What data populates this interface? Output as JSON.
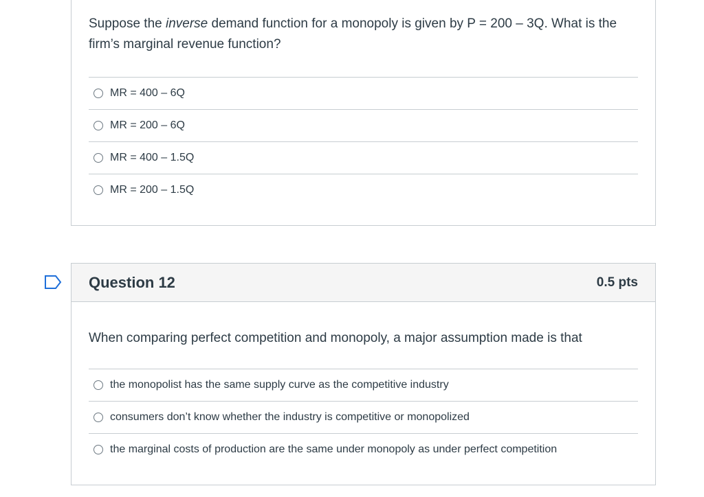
{
  "question11": {
    "text_before": "Suppose the ",
    "text_em": "inverse",
    "text_after": " demand function for a monopoly is given by P = 200 – 3Q.  What is the firm’s marginal revenue function?",
    "answers": [
      {
        "label": "MR = 400 – 6Q"
      },
      {
        "label": "MR = 200 – 6Q"
      },
      {
        "label": "MR = 400 – 1.5Q"
      },
      {
        "label": "MR = 200 – 1.5Q"
      }
    ]
  },
  "question12": {
    "title": "Question 12",
    "points": "0.5 pts",
    "text": "When comparing perfect competition and monopoly, a major assumption made is that",
    "answers": [
      {
        "label": "the monopolist has the same supply curve as the competitive industry"
      },
      {
        "label": "consumers don’t know whether the industry is competitive or monopolized"
      },
      {
        "label": "the marginal costs of production are the same under monopoly as under perfect competition"
      }
    ]
  },
  "colors": {
    "text": "#2d3b45",
    "border": "#c7cdd1",
    "header_bg": "#f5f5f5",
    "flag": "#1e6fd9"
  },
  "icons": {
    "flag": "flag-question-icon",
    "radio": "radio-icon"
  }
}
